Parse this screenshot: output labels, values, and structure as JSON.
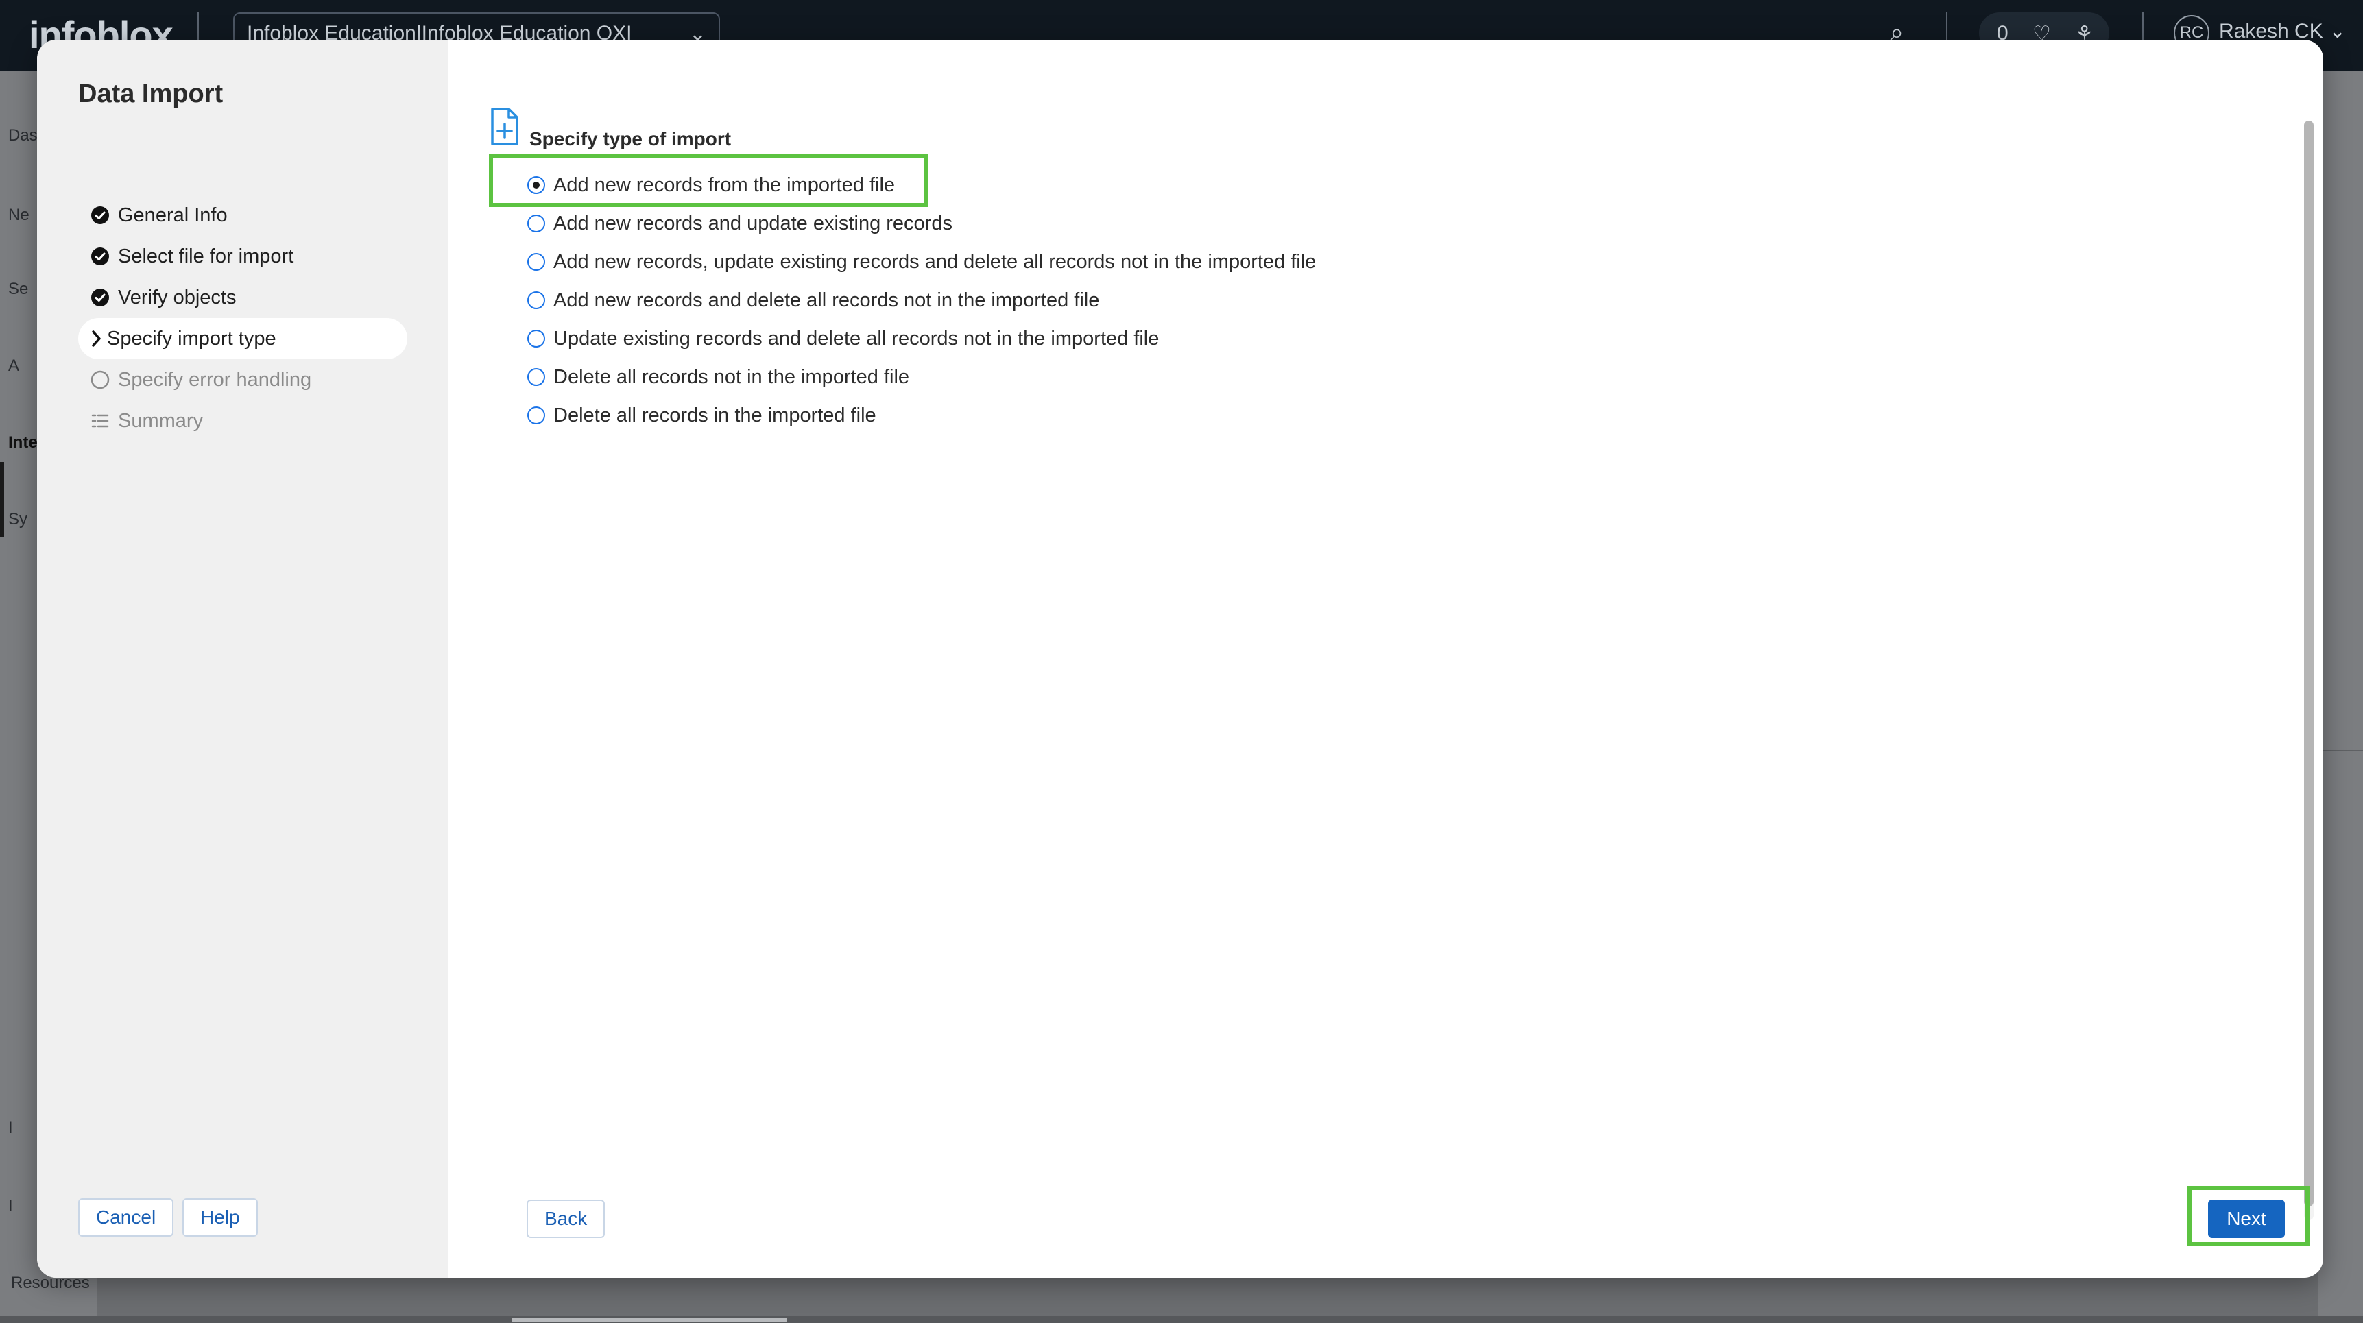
{
  "app": {
    "logo_text": "infoblox",
    "account_selector": "Infoblox Education|Infoblox Education OXI",
    "notification_count": "0",
    "user_initials": "RC",
    "user_name": "Rakesh CK"
  },
  "background_nav": {
    "fragments": [
      "Das",
      "Ne",
      "Se",
      "A",
      "Inte",
      "Sy",
      "I",
      "I",
      "Resources"
    ]
  },
  "dialog": {
    "title": "Data Import",
    "steps": [
      {
        "label": "General Info",
        "state": "completed",
        "icon": "check-circle-icon"
      },
      {
        "label": "Select file for import",
        "state": "completed",
        "icon": "check-circle-icon"
      },
      {
        "label": "Verify objects",
        "state": "completed",
        "icon": "check-circle-icon"
      },
      {
        "label": "Specify import type",
        "state": "current",
        "icon": "chevron-right-icon"
      },
      {
        "label": "Specify error handling",
        "state": "pending",
        "icon": "empty-circle-icon"
      },
      {
        "label": "Summary",
        "state": "pending",
        "icon": "list-icon"
      }
    ],
    "cancel_label": "Cancel",
    "help_label": "Help"
  },
  "main": {
    "section_title": "Specify type of import",
    "section_icon": "file-plus-icon",
    "options": [
      {
        "label": "Add new records from the imported file",
        "checked": true
      },
      {
        "label": "Add new records and update existing records",
        "checked": false
      },
      {
        "label": "Add new records, update existing records and delete all records not in the imported file",
        "checked": false
      },
      {
        "label": "Add new records and delete all records not in the imported file",
        "checked": false
      },
      {
        "label": "Update existing records and delete all records not in the imported file",
        "checked": false
      },
      {
        "label": "Delete all records not in the imported file",
        "checked": false
      },
      {
        "label": "Delete all records in the imported file",
        "checked": false
      }
    ],
    "back_label": "Back",
    "next_label": "Next"
  },
  "colors": {
    "accent_blue": "#1565c0",
    "highlight_green": "#5cc341",
    "sidebar_bg": "#f0f0f0"
  }
}
